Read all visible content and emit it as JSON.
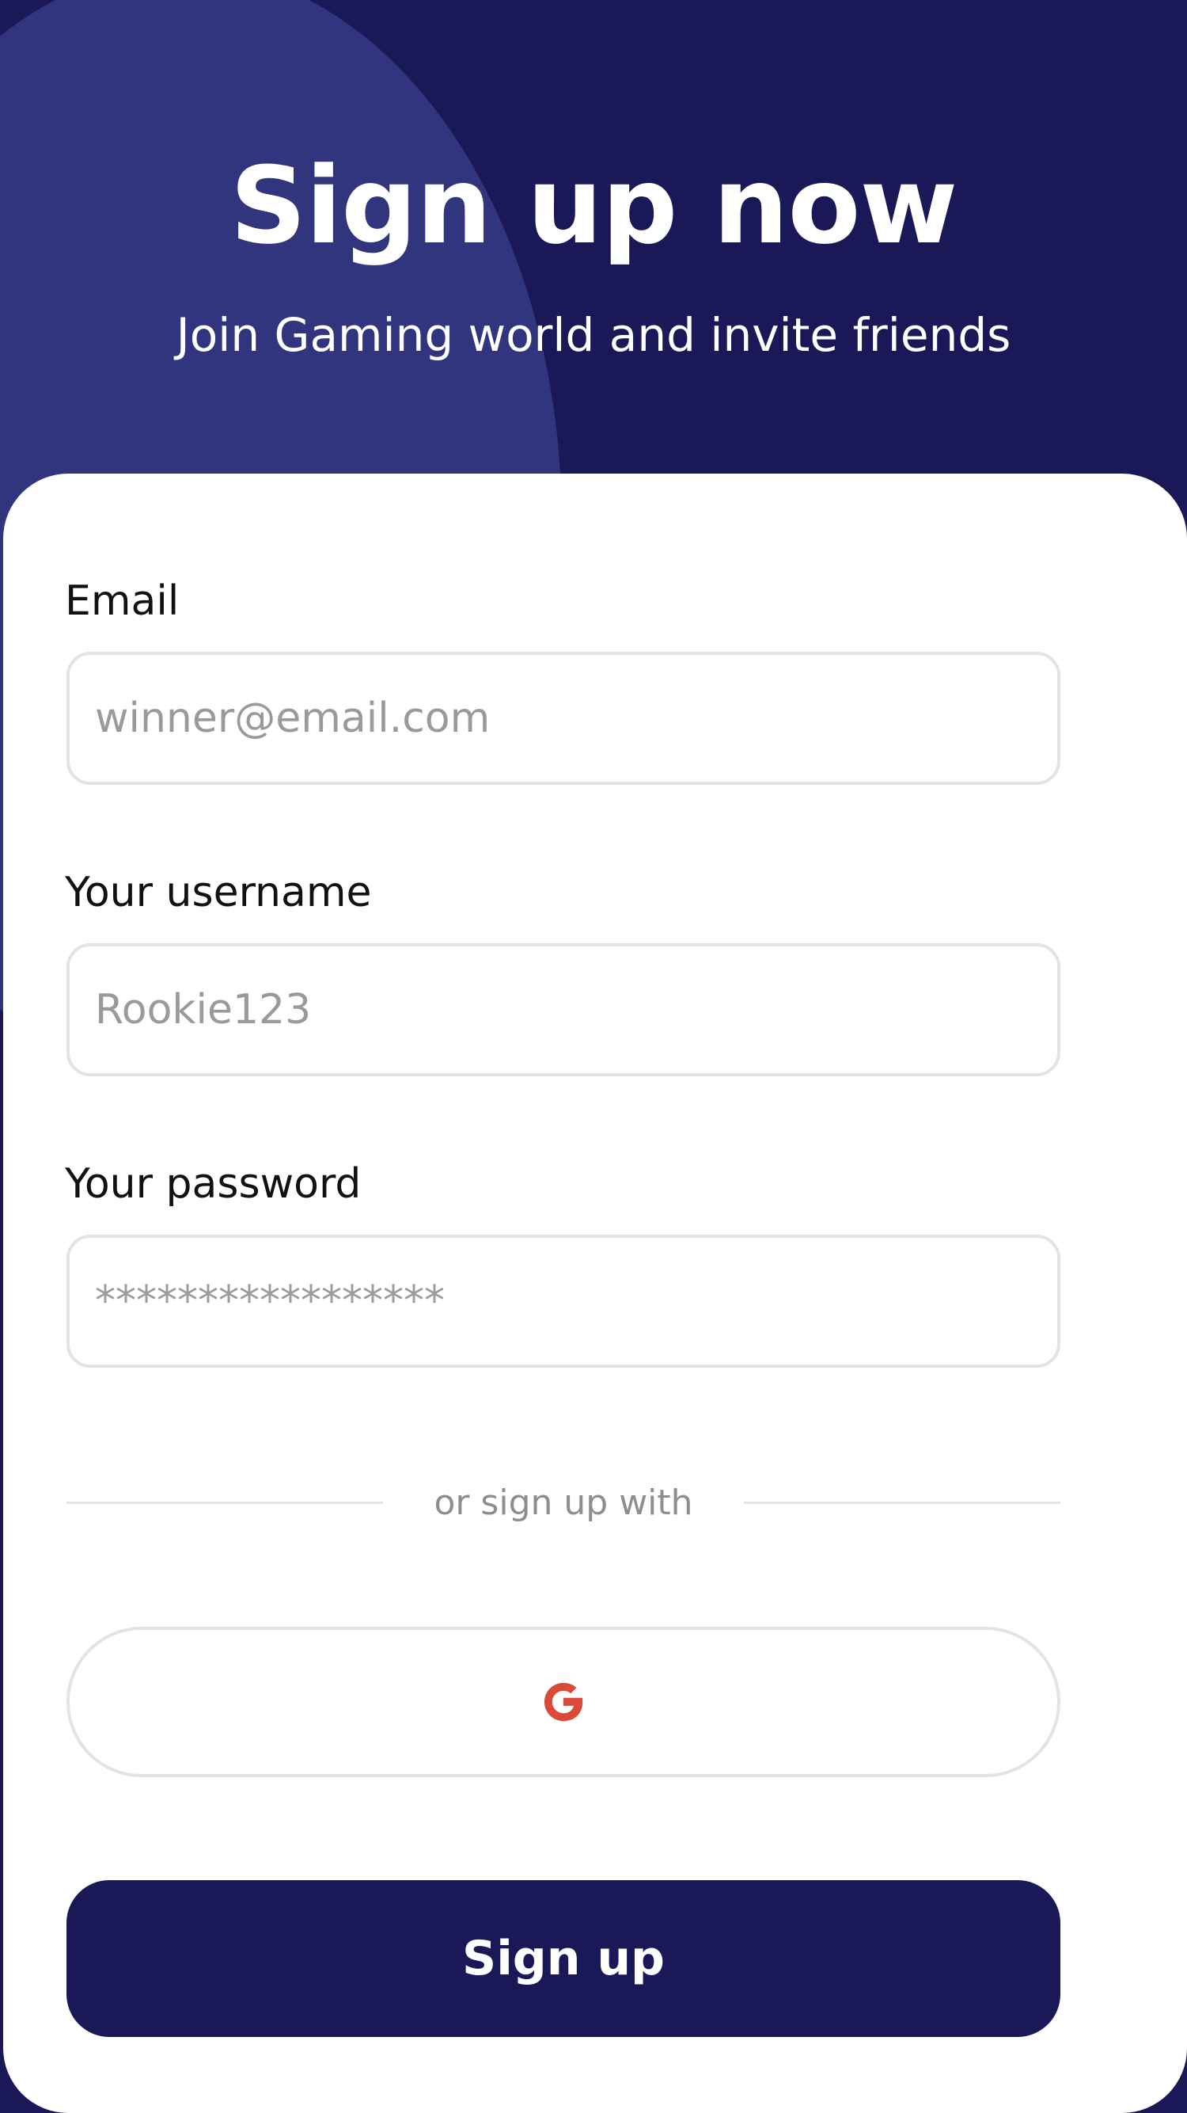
{
  "header": {
    "title": "Sign up now",
    "subtitle": "Join Gaming world and invite friends"
  },
  "form": {
    "email": {
      "label": "Email",
      "value": "",
      "placeholder": "winner@email.com"
    },
    "username": {
      "label": "Your username",
      "value": "",
      "placeholder": "Rookie123"
    },
    "password": {
      "label": "Your password",
      "value": "",
      "placeholder": "*****************"
    }
  },
  "social": {
    "divider_text": "or sign up with",
    "google_icon": "google-g-icon"
  },
  "actions": {
    "signup_label": "Sign up"
  },
  "colors": {
    "primary": "#1b1858",
    "accent_blob": "#33377f",
    "google_red": "#db4a39",
    "placeholder": "#9a9a9a",
    "border": "#e3e3e3"
  }
}
